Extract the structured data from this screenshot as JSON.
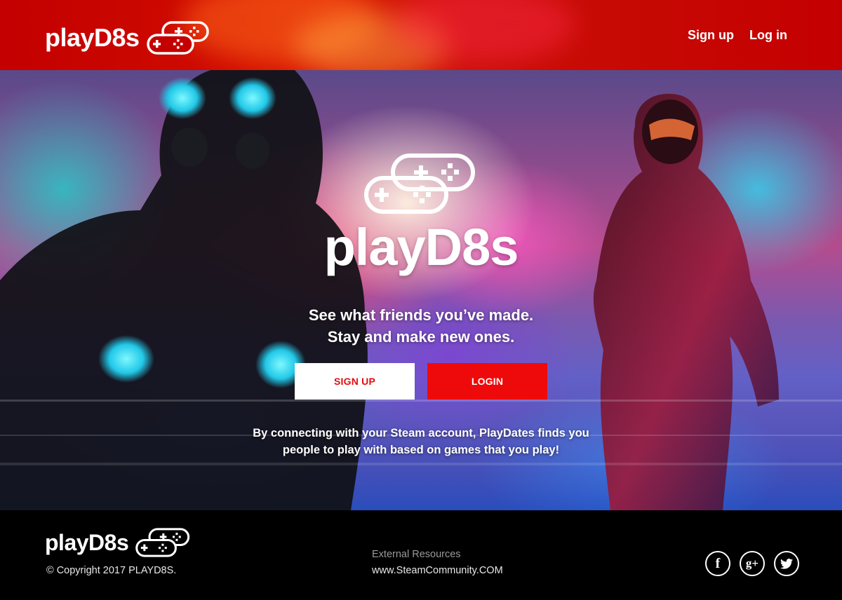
{
  "header": {
    "brand": "playD8s",
    "nav": {
      "signup": "Sign up",
      "login": "Log in"
    }
  },
  "hero": {
    "title": "playD8s",
    "tagline_line1": "See what friends you’ve made.",
    "tagline_line2": "Stay and make new ones.",
    "signup_button": "SIGN UP",
    "login_button": "LOGIN",
    "blurb_line1": "By connecting with your Steam account, PlayDates finds you",
    "blurb_line2": "people to play with based on games that you play!"
  },
  "footer": {
    "brand": "playD8s",
    "copyright": "© Copyright 2017 PLAYD8S.",
    "resources_title": "External Resources",
    "resources_link": "www.SteamCommunity.COM",
    "socials": [
      {
        "icon": "facebook-icon",
        "glyph": "f"
      },
      {
        "icon": "google-plus-icon",
        "glyph": "g+"
      },
      {
        "icon": "twitter-icon",
        "glyph": ""
      }
    ]
  },
  "colors": {
    "header_red": "#c40000",
    "button_red": "#ee0a0a",
    "button_white": "#ffffff",
    "footer_bg": "#000000"
  }
}
